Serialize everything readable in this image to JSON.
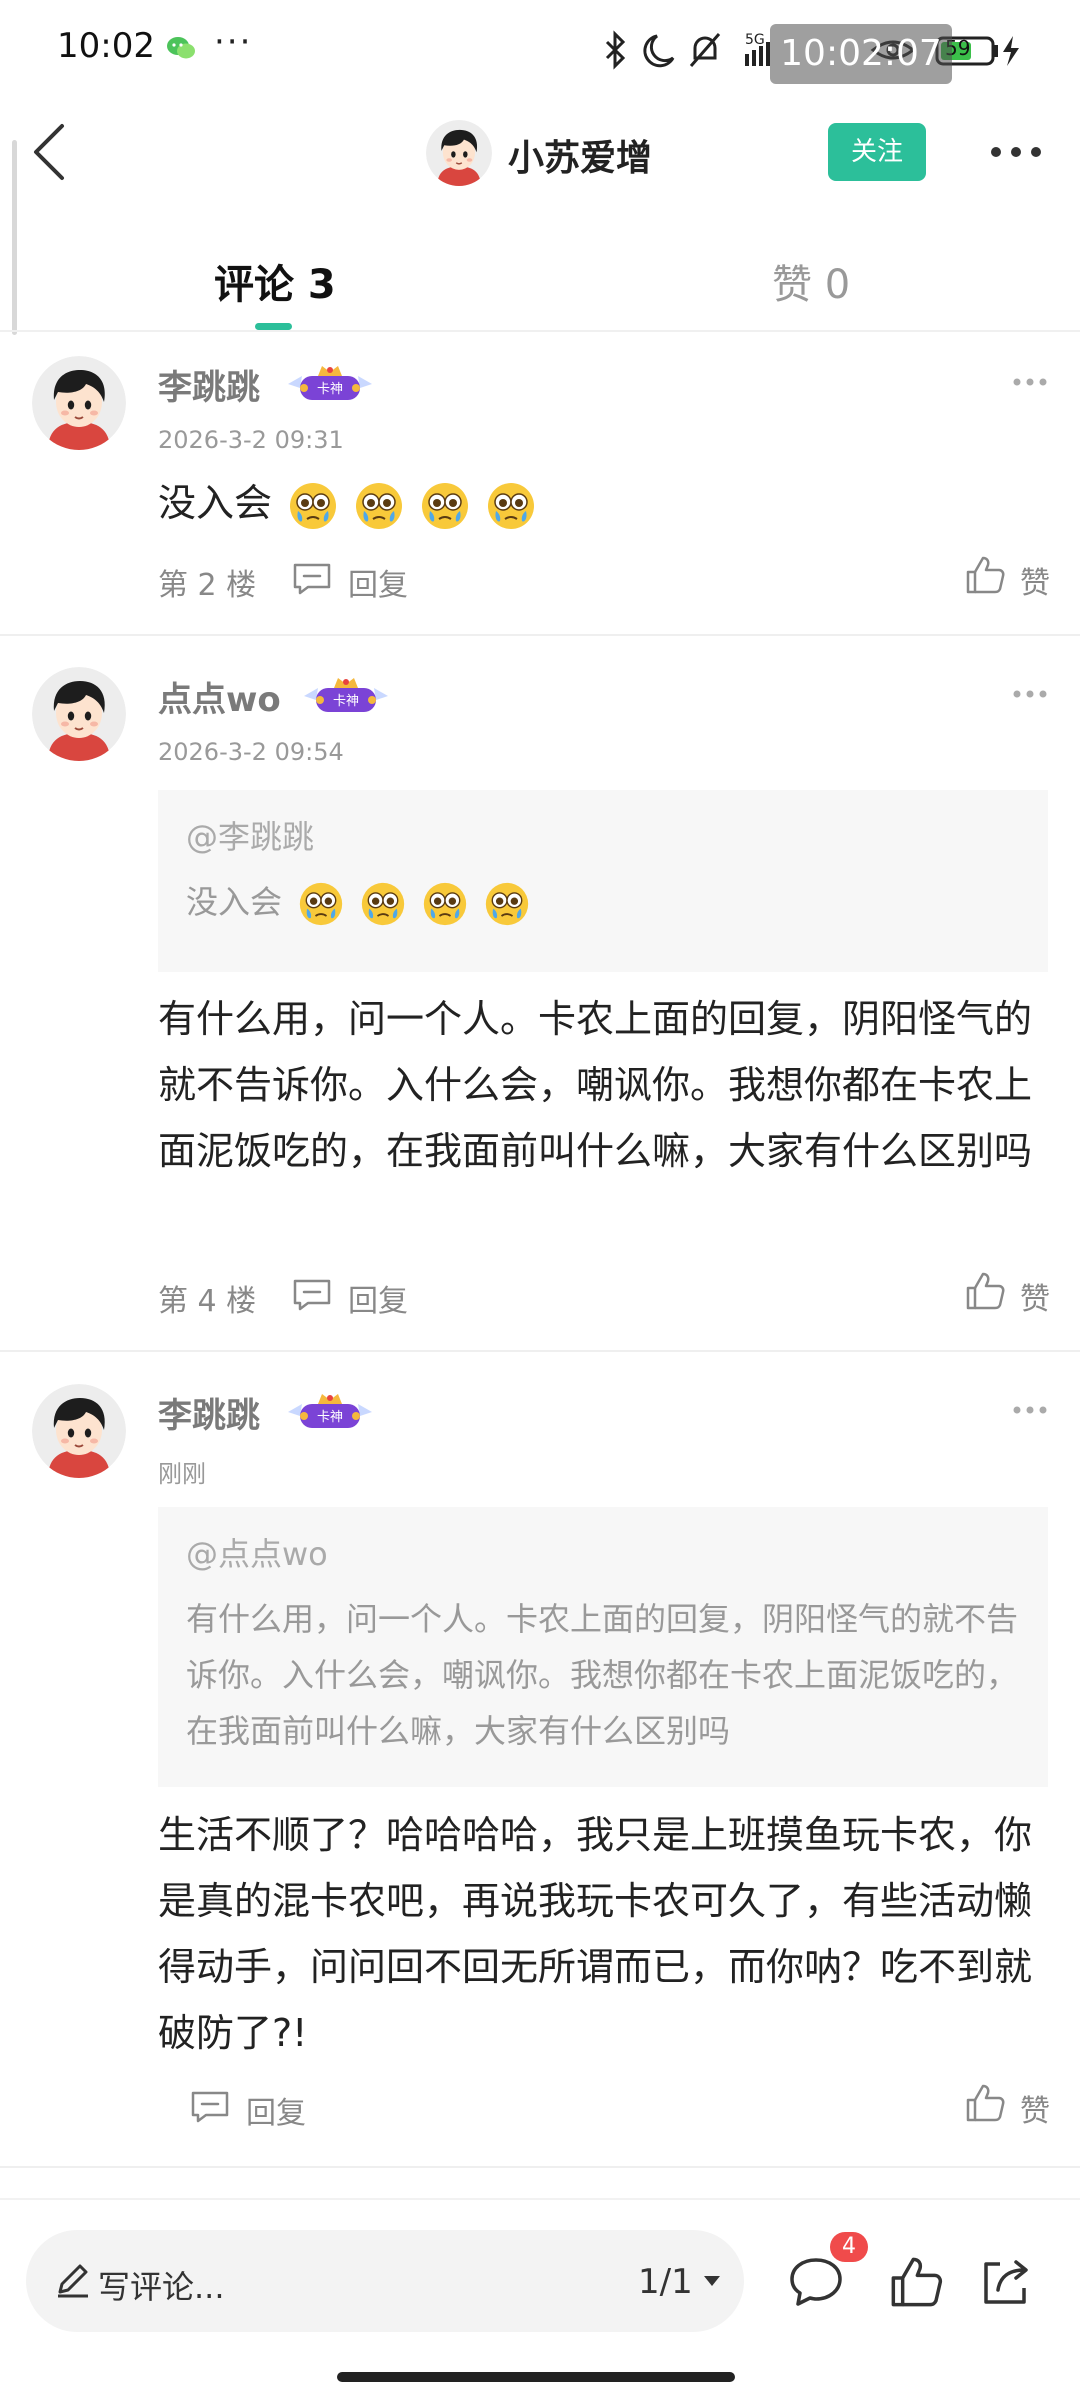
{
  "status_bar": {
    "time": "10:02",
    "more": "···",
    "battery": "59",
    "overlay_time": "10:02:07",
    "network": "5G"
  },
  "header": {
    "username": "小苏爱增",
    "follow_label": "关注"
  },
  "tabs": [
    {
      "label": "评论 3",
      "active": true
    },
    {
      "label": "赞 0",
      "active": false
    }
  ],
  "badge_text": "卡神",
  "comments": [
    {
      "username": "李跳跳",
      "time": "2026-3-2 09:31",
      "text": "没入会",
      "emoji_count": 4,
      "floor": "第 2 楼",
      "reply_label": "回复",
      "like_label": "赞"
    },
    {
      "username": "点点wo",
      "time": "2026-3-2 09:54",
      "quote_mention": "@李跳跳",
      "quote_text": "没入会",
      "quote_emoji_count": 4,
      "text": "有什么用，问一个人。卡农上面的回复，阴阳怪气的就不告诉你。入什么会，嘲讽你。我想你都在卡农上面泥饭吃的，在我面前叫什么嘛，大家有什么区别吗",
      "floor": "第 4 楼",
      "reply_label": "回复",
      "like_label": "赞"
    },
    {
      "username": "李跳跳",
      "time": "刚刚",
      "quote_mention": "@点点wo",
      "quote_text": "有什么用，问一个人。卡农上面的回复，阴阳怪气的就不告诉你。入什么会，嘲讽你。我想你都在卡农上面泥饭吃的，在我面前叫什么嘛，大家有什么区别吗",
      "text": "生活不顺了？哈哈哈哈，我只是上班摸鱼玩卡农，你是真的混卡农吧，再说我玩卡农可久了，有些活动懒得动手，问问回不回无所谓而已，而你呐？吃不到就破防了?!",
      "reply_label": "回复",
      "like_label": "赞"
    }
  ],
  "bottom_bar": {
    "write_placeholder": "写评论...",
    "page": "1/1",
    "comment_count_badge": "4"
  },
  "colors": {
    "accent": "#2cbf9a",
    "badge_red": "#f04b4b"
  }
}
